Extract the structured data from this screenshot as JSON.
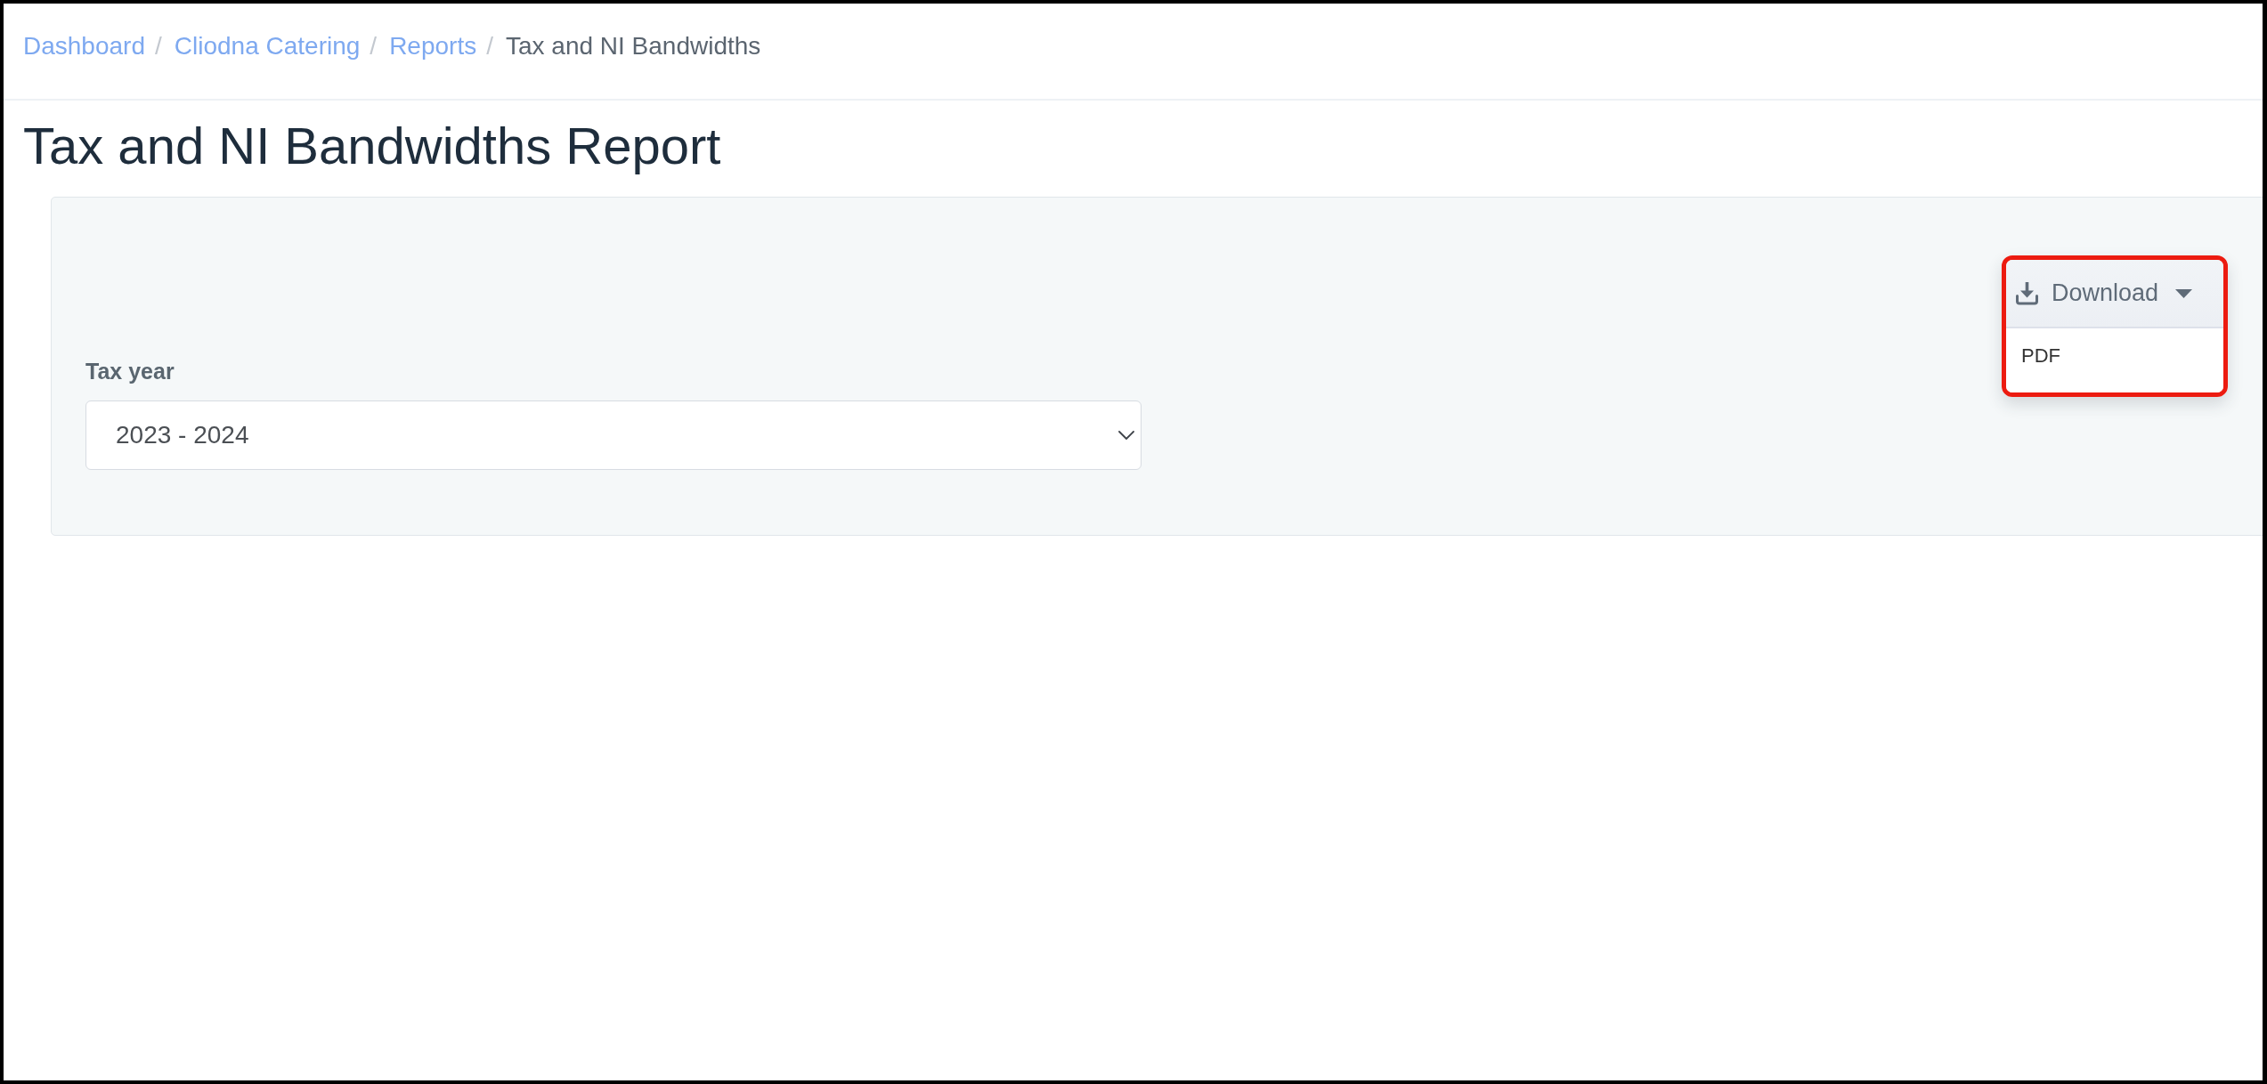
{
  "breadcrumb": [
    {
      "label": "Dashboard",
      "kind": "link",
      "separator": "/"
    },
    {
      "label": "Cliodna Catering",
      "kind": "link",
      "separator": "/"
    },
    {
      "label": "Reports",
      "kind": "link",
      "separator": "/"
    },
    {
      "label": "Tax and NI Bandwidths",
      "kind": "current"
    }
  ],
  "page_title": "Tax and NI Bandwidths Report",
  "filters": {
    "tax_year": {
      "label": "Tax year",
      "value": "2023 - 2024"
    },
    "download": {
      "label": "Download",
      "expanded": true,
      "highlighted": true,
      "menu_items": [
        "PDF"
      ]
    }
  }
}
